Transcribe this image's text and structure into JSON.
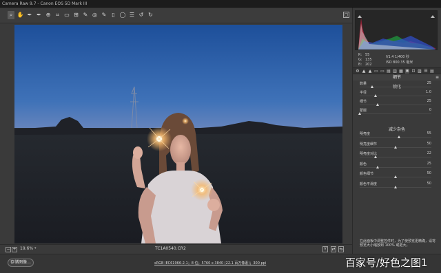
{
  "window": {
    "title": "Camera Raw 9.7  -  Canon EOS 5D Mark III"
  },
  "toolbar": {
    "tools": [
      {
        "name": "zoom-tool-icon",
        "glyph": "⌕",
        "selected": true
      },
      {
        "name": "hand-tool-icon",
        "glyph": "✋",
        "selected": false
      },
      {
        "name": "white-balance-tool-icon",
        "glyph": "✒",
        "selected": false
      },
      {
        "name": "color-sampler-tool-icon",
        "glyph": "✒",
        "selected": false
      },
      {
        "name": "targeted-adjustment-tool-icon",
        "glyph": "⊕",
        "selected": false
      },
      {
        "name": "crop-tool-icon",
        "glyph": "⌗",
        "selected": false
      },
      {
        "name": "straighten-tool-icon",
        "glyph": "▭",
        "selected": false
      },
      {
        "name": "transform-tool-icon",
        "glyph": "⊞",
        "selected": false
      },
      {
        "name": "spot-removal-tool-icon",
        "glyph": "✎",
        "selected": false
      },
      {
        "name": "red-eye-tool-icon",
        "glyph": "◎",
        "selected": false
      },
      {
        "name": "adjustment-brush-icon",
        "glyph": "✎",
        "selected": false
      },
      {
        "name": "graduated-filter-icon",
        "glyph": "▯",
        "selected": false
      },
      {
        "name": "radial-filter-icon",
        "glyph": "◯",
        "selected": false
      },
      {
        "name": "preferences-icon",
        "glyph": "☰",
        "selected": false
      },
      {
        "name": "rotate-ccw-icon",
        "glyph": "↺",
        "selected": false
      },
      {
        "name": "rotate-cw-icon",
        "glyph": "↻",
        "selected": false
      }
    ],
    "fullscreen_icon": "fullscreen-icon"
  },
  "preview": {
    "zoom_value": "19.6%",
    "zoom_dropdown": "▾",
    "filename": "TC1A0540.CR2",
    "zoom_out": "−",
    "zoom_in": "+",
    "view_buttons": [
      "Y",
      "⇄",
      "⇆"
    ]
  },
  "histogram": {
    "readout": {
      "r_label": "R:",
      "r_value": "55",
      "g_label": "G:",
      "g_value": "135",
      "b_label": "B:",
      "b_value": "202",
      "exposure": "f/1.4   1/400 秒",
      "iso_lens": "ISO 800   35 毫米"
    }
  },
  "panel": {
    "tabs": [
      "⚙",
      "▲",
      "▲",
      "▭",
      "▭",
      "▤",
      "▥",
      "▦",
      "✱",
      "⊡",
      "▨",
      "☰",
      "▤"
    ],
    "title": "细节",
    "menu": "≡",
    "sharpen_title": "锐化",
    "noise_title": "减少杂色",
    "sharpen": [
      {
        "label": "数量",
        "value": "25",
        "pos": 0.17
      },
      {
        "label": "半径",
        "value": "1.0",
        "pos": 0.22
      },
      {
        "label": "细节",
        "value": "25",
        "pos": 0.25
      },
      {
        "label": "蒙版",
        "value": "0",
        "pos": 0.0
      }
    ],
    "noise": [
      {
        "label": "明亮度",
        "value": "55",
        "pos": 0.55
      },
      {
        "label": "明亮度细节",
        "value": "50",
        "pos": 0.5
      },
      {
        "label": "明亮度对比",
        "value": "22",
        "pos": 0.22
      },
      {
        "label": "颜色",
        "value": "25",
        "pos": 0.25
      },
      {
        "label": "颜色细节",
        "value": "50",
        "pos": 0.5
      },
      {
        "label": "颜色平滑度",
        "value": "50",
        "pos": 0.5
      }
    ],
    "note": "在此面板中调整控件时，为了使预览更精确，请将预览大小缩放到 100% 或更大。"
  },
  "footer": {
    "save_label": "存储图像...",
    "workflow_label": "sRGB IEC61966-2.1；8 位；5760 x 3840 (22.1 百万像素)；300 ppi",
    "watermark": "百家号/好色之图1"
  },
  "colors": {
    "accent": "#d6d6d6",
    "background": "#3a3a3a",
    "toolbar": "#3c3c3c"
  }
}
